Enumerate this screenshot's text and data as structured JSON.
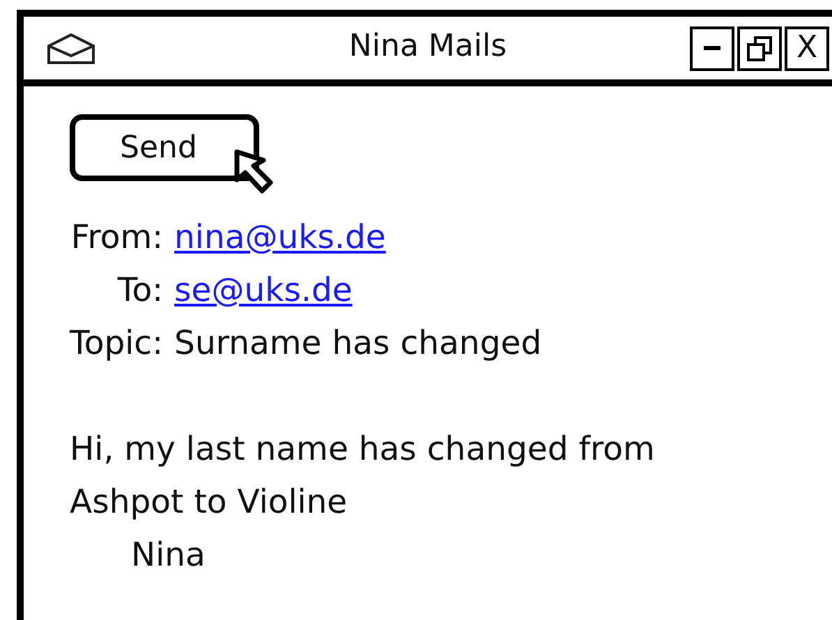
{
  "window": {
    "title": "Nina Mails",
    "close_label": "X"
  },
  "toolbar": {
    "send_button": "Send"
  },
  "message": {
    "fields": [
      {
        "label": "From:",
        "value": "nina@uks.de",
        "kind": "link"
      },
      {
        "label": "To:",
        "value": "se@uks.de",
        "kind": "link"
      },
      {
        "label": "Topic:",
        "value": "Surname has changed",
        "kind": "text"
      }
    ],
    "body": "Hi, my last name has changed from\nAshpot to Violine",
    "signature": "Nina"
  }
}
